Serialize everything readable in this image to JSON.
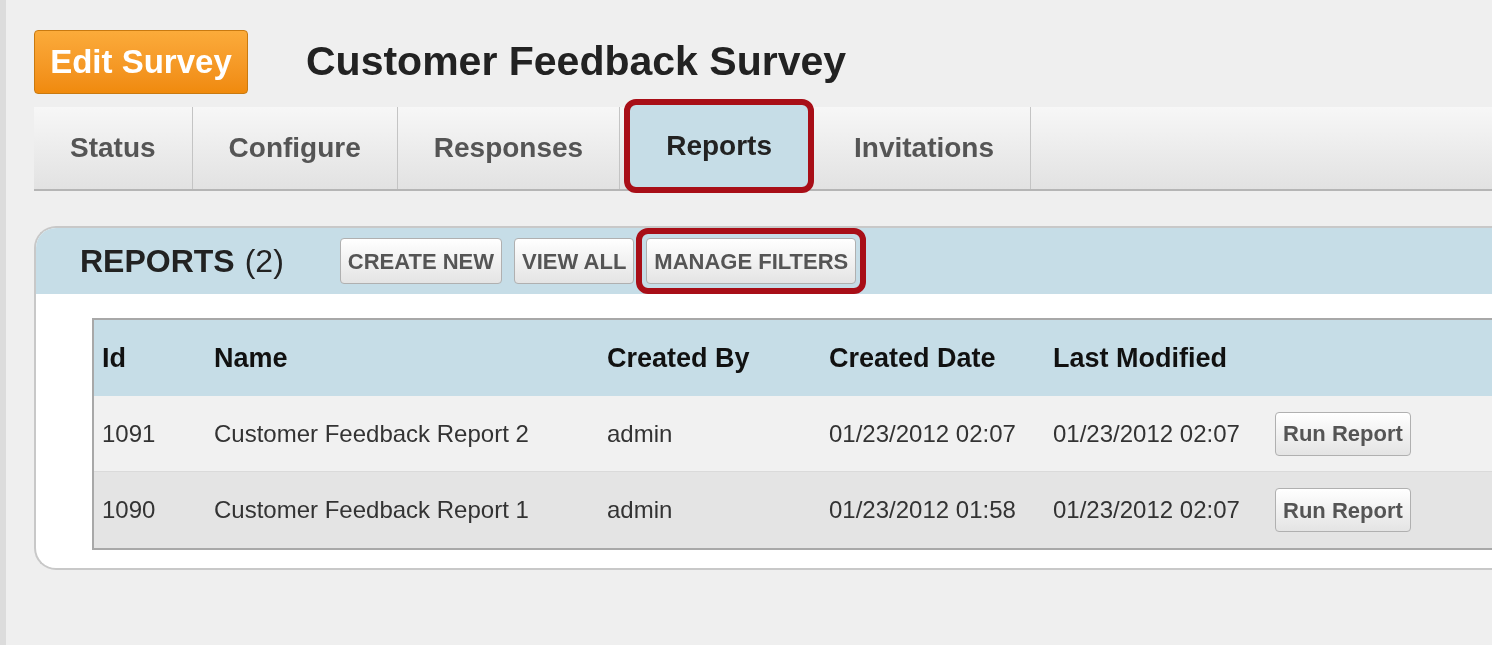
{
  "edit_button": "Edit Survey",
  "title": "Customer Feedback Survey",
  "tabs": [
    {
      "label": "Status",
      "selected": false,
      "highlighted": false
    },
    {
      "label": "Configure",
      "selected": false,
      "highlighted": false
    },
    {
      "label": "Responses",
      "selected": false,
      "highlighted": false
    },
    {
      "label": "Reports",
      "selected": true,
      "highlighted": true
    },
    {
      "label": "Invitations",
      "selected": false,
      "highlighted": false
    }
  ],
  "panel": {
    "heading": "REPORTS",
    "count": "(2)",
    "buttons": [
      {
        "label": "CREATE NEW",
        "highlighted": false
      },
      {
        "label": "VIEW ALL",
        "highlighted": false
      },
      {
        "label": "MANAGE FILTERS",
        "highlighted": true
      }
    ]
  },
  "table": {
    "columns": [
      "Id",
      "Name",
      "Created By",
      "Created Date",
      "Last Modified"
    ],
    "rows": [
      {
        "cells": [
          "1091",
          "Customer Feedback Report 2",
          "admin",
          "01/23/2012 02:07",
          "01/23/2012 02:07"
        ],
        "action": "Run Report"
      },
      {
        "cells": [
          "1090",
          "Customer Feedback Report 1",
          "admin",
          "01/23/2012 01:58",
          "01/23/2012 02:07"
        ],
        "action": "Run Report"
      }
    ]
  }
}
